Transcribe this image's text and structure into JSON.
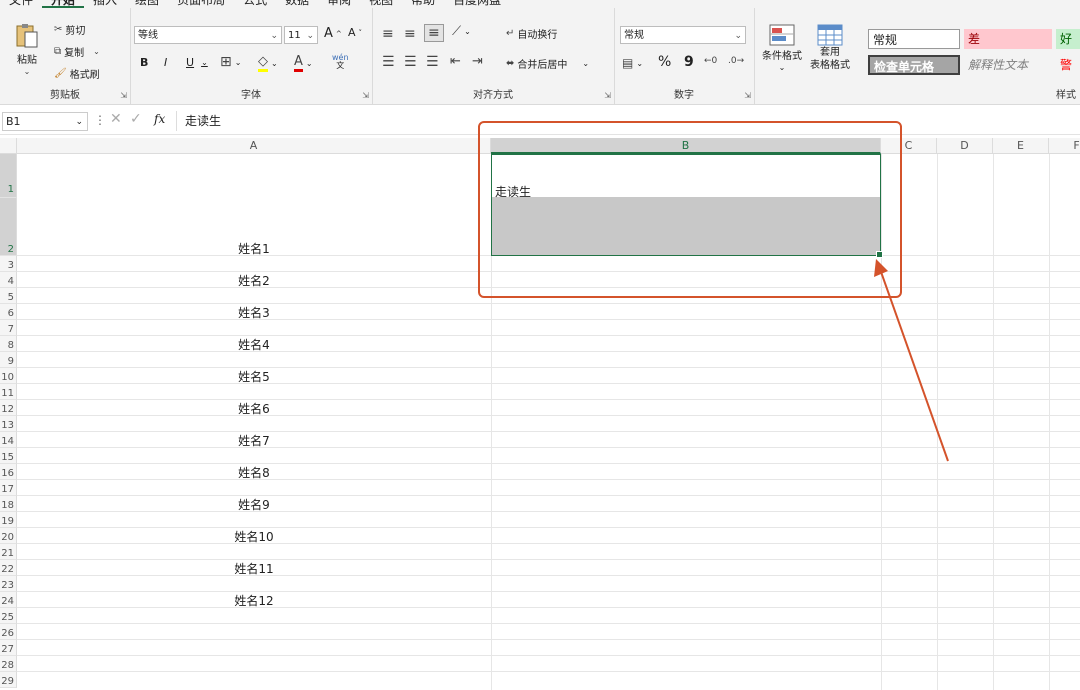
{
  "menu": [
    "文件",
    "开始",
    "插入",
    "绘图",
    "页面布局",
    "公式",
    "数据",
    "审阅",
    "视图",
    "帮助",
    "百度网盘"
  ],
  "ribbon": {
    "clipboard": {
      "paste": "粘贴",
      "cut": "剪切",
      "copy": "复制",
      "format_painter": "格式刷",
      "label": "剪贴板"
    },
    "font": {
      "name": "等线",
      "size": "11",
      "bold": "B",
      "italic": "I",
      "underline": "U",
      "label": "字体",
      "grow": "A",
      "shrink": "A",
      "phonetic": "wén"
    },
    "alignment": {
      "wrap": "自动换行",
      "merge": "合并后居中",
      "label": "对齐方式"
    },
    "number": {
      "format": "常规",
      "percent": "%",
      "comma": "9",
      "label": "数字"
    },
    "styles": {
      "conditional": "条件格式",
      "table_line1": "套用",
      "table_line2": "表格格式",
      "normal": "常规",
      "bad": "差",
      "good": "好",
      "check_cell": "检查单元格",
      "explanatory": "解释性文本",
      "warning": "警告",
      "label": "样式"
    }
  },
  "formula_bar": {
    "name_box": "B1",
    "fx": "fx",
    "content": "走读生"
  },
  "columns": [
    "A",
    "B",
    "C",
    "D",
    "E",
    "F"
  ],
  "rows": [
    "1",
    "2",
    "3",
    "4",
    "5",
    "6",
    "7",
    "8",
    "9",
    "10",
    "11",
    "12",
    "13",
    "14",
    "15",
    "16",
    "17",
    "18",
    "19",
    "20",
    "21",
    "22",
    "23",
    "24",
    "25",
    "26",
    "27",
    "28",
    "29"
  ],
  "cells": {
    "B1": "走读生",
    "A": [
      "姓名1",
      "姓名2",
      "姓名3",
      "姓名4",
      "姓名5",
      "姓名6",
      "姓名7",
      "姓名8",
      "姓名9",
      "姓名10",
      "姓名11",
      "姓名12"
    ]
  },
  "colors": {
    "accent": "#217346",
    "annotation": "#d4532b",
    "selection_fill": "#c8c8c8",
    "bad_bg": "#ffc7ce",
    "good_bg": "#c6efce",
    "check_bg": "#a5a5a5"
  }
}
